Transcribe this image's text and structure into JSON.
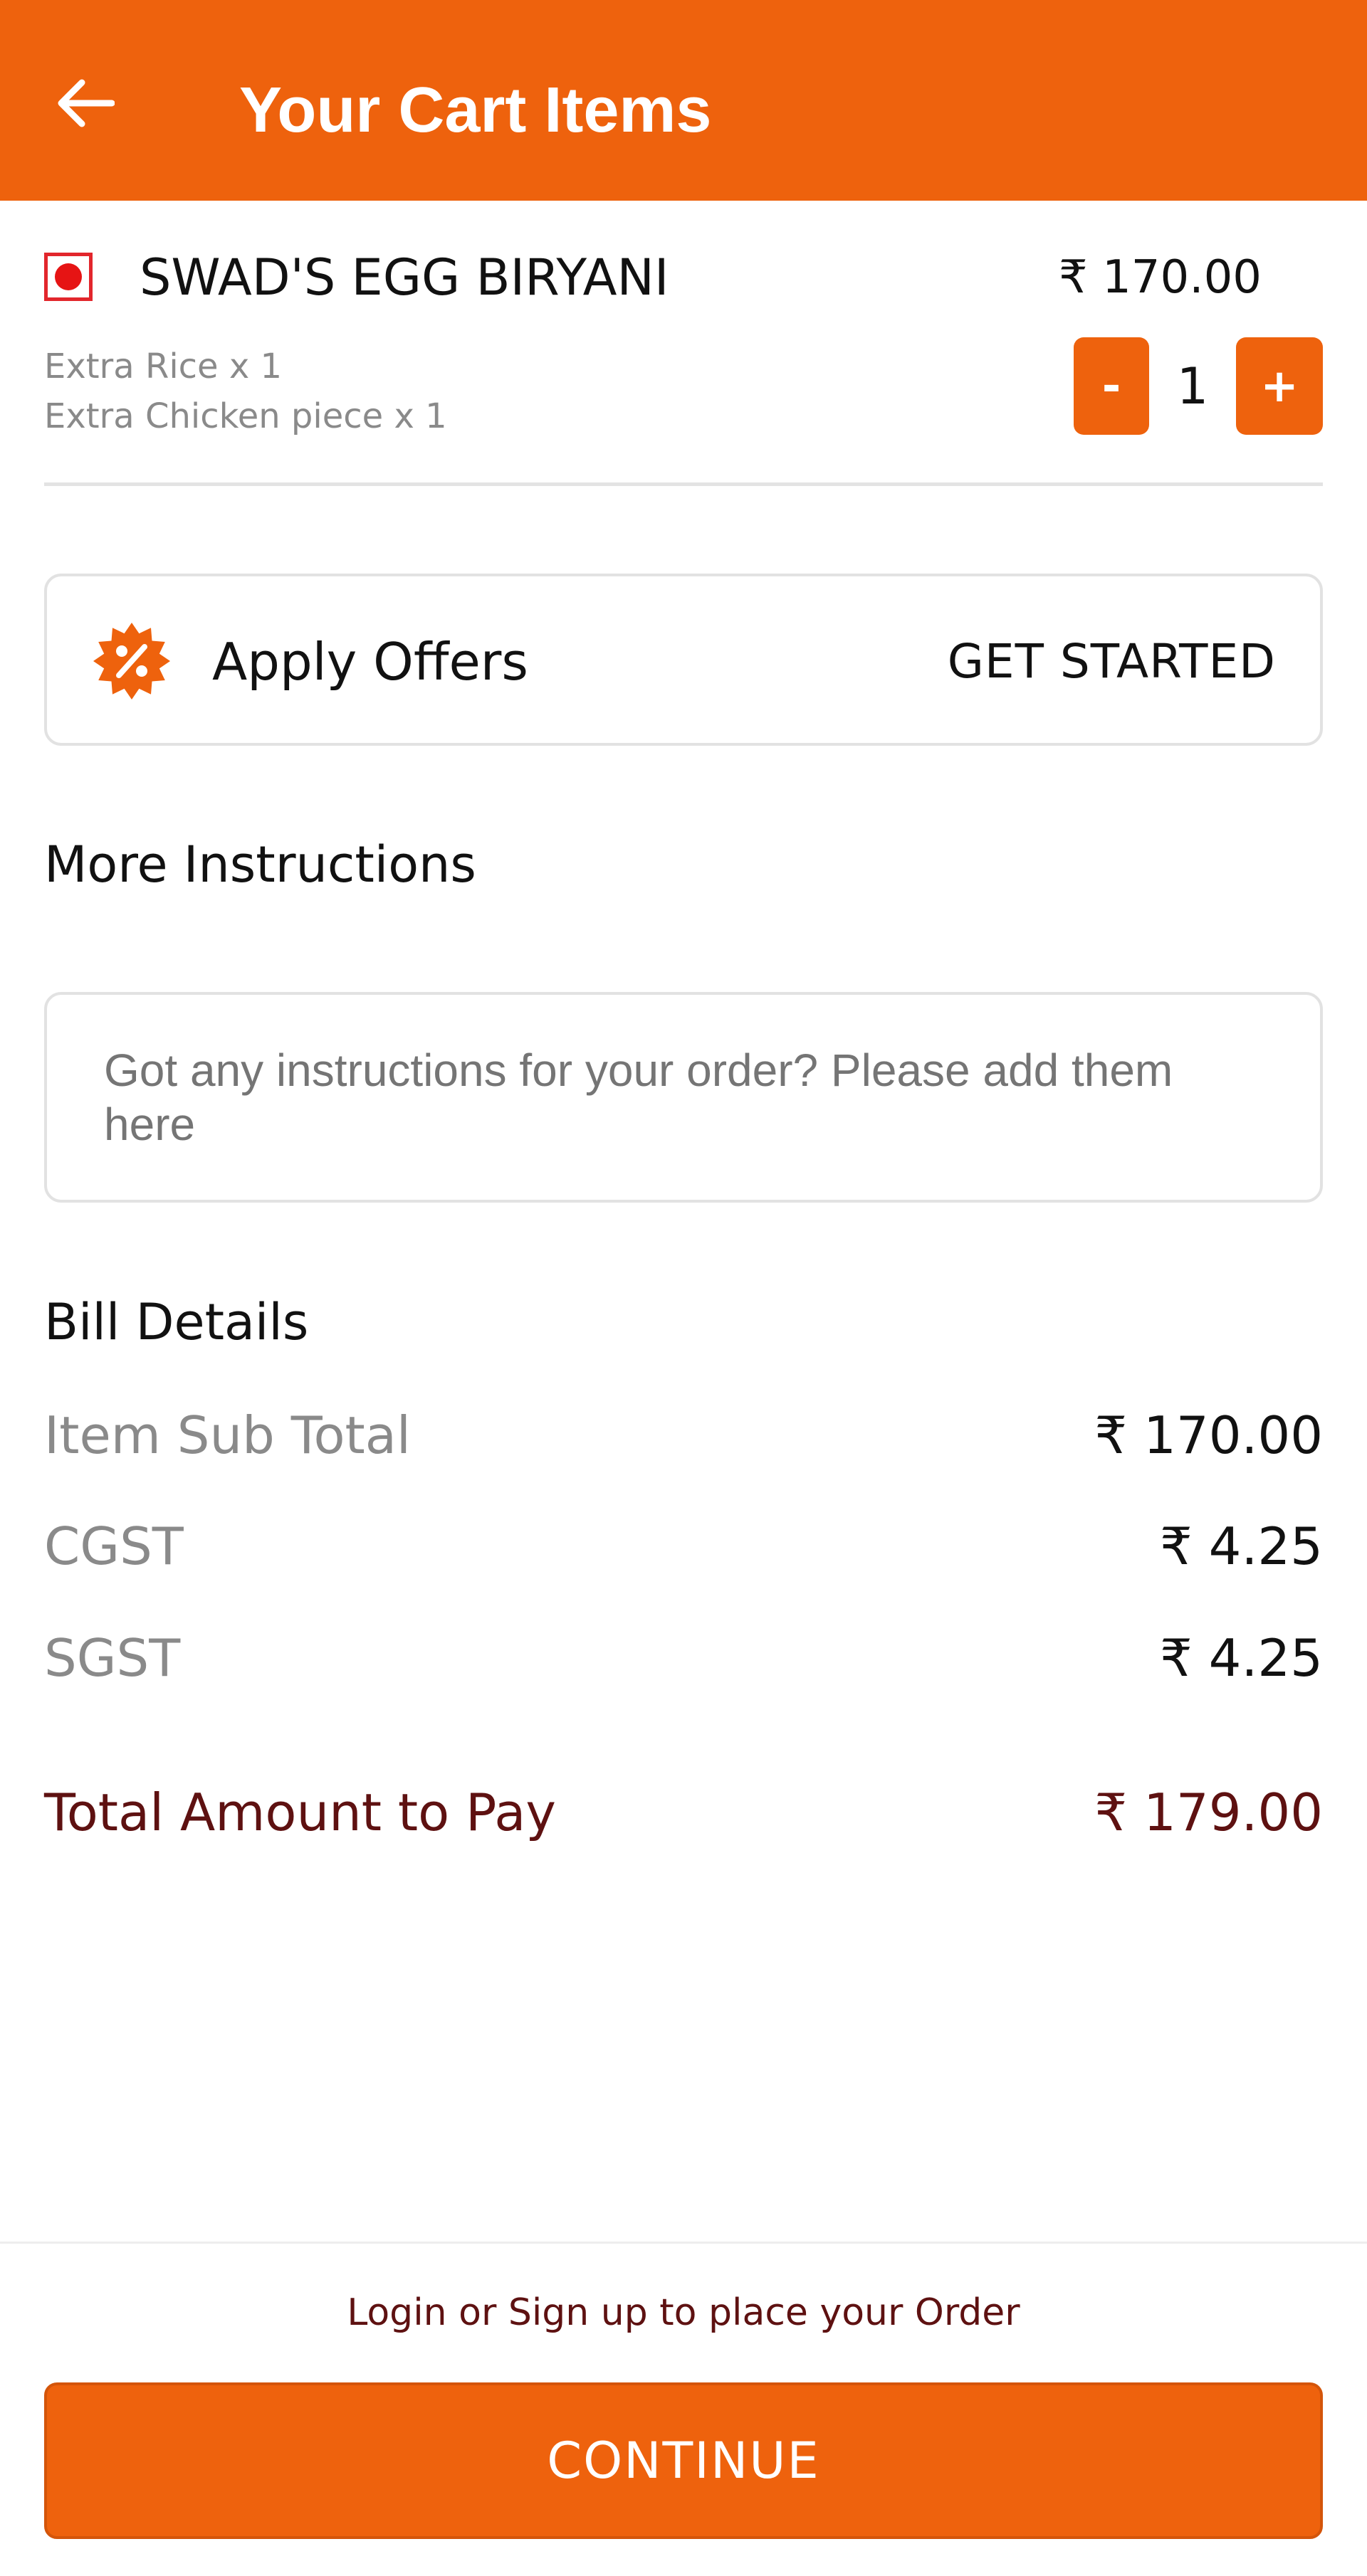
{
  "colors": {
    "accent": "#ee620d",
    "total_text": "#5e1111",
    "nonveg_mark": "#e2262c"
  },
  "header": {
    "back_icon": "arrow-left-icon",
    "title": "Your Cart Items"
  },
  "cart": {
    "items": [
      {
        "type_icon": "non-veg-mark-icon",
        "name": "SWAD'S EGG BIRYANI",
        "price": "₹ 170.00",
        "addons": [
          "Extra Rice x 1",
          "Extra Chicken piece x 1"
        ],
        "decrement_label": "-",
        "quantity": "1",
        "increment_label": "+"
      }
    ]
  },
  "offers": {
    "icon": "discount-badge-icon",
    "label": "Apply Offers",
    "action": "GET STARTED"
  },
  "instructions": {
    "title": "More Instructions",
    "placeholder": "Got any instructions for your order? Please add them here"
  },
  "bill": {
    "title": "Bill Details",
    "rows": [
      {
        "label": "Item Sub Total",
        "value": "₹ 170.00"
      },
      {
        "label": "CGST",
        "value": "₹ 4.25"
      },
      {
        "label": "SGST",
        "value": "₹ 4.25"
      }
    ],
    "total_label": "Total Amount to Pay",
    "total_value": "₹ 179.00"
  },
  "footer": {
    "login_prompt": "Login or Sign up to place your Order",
    "continue_label": "CONTINUE"
  }
}
